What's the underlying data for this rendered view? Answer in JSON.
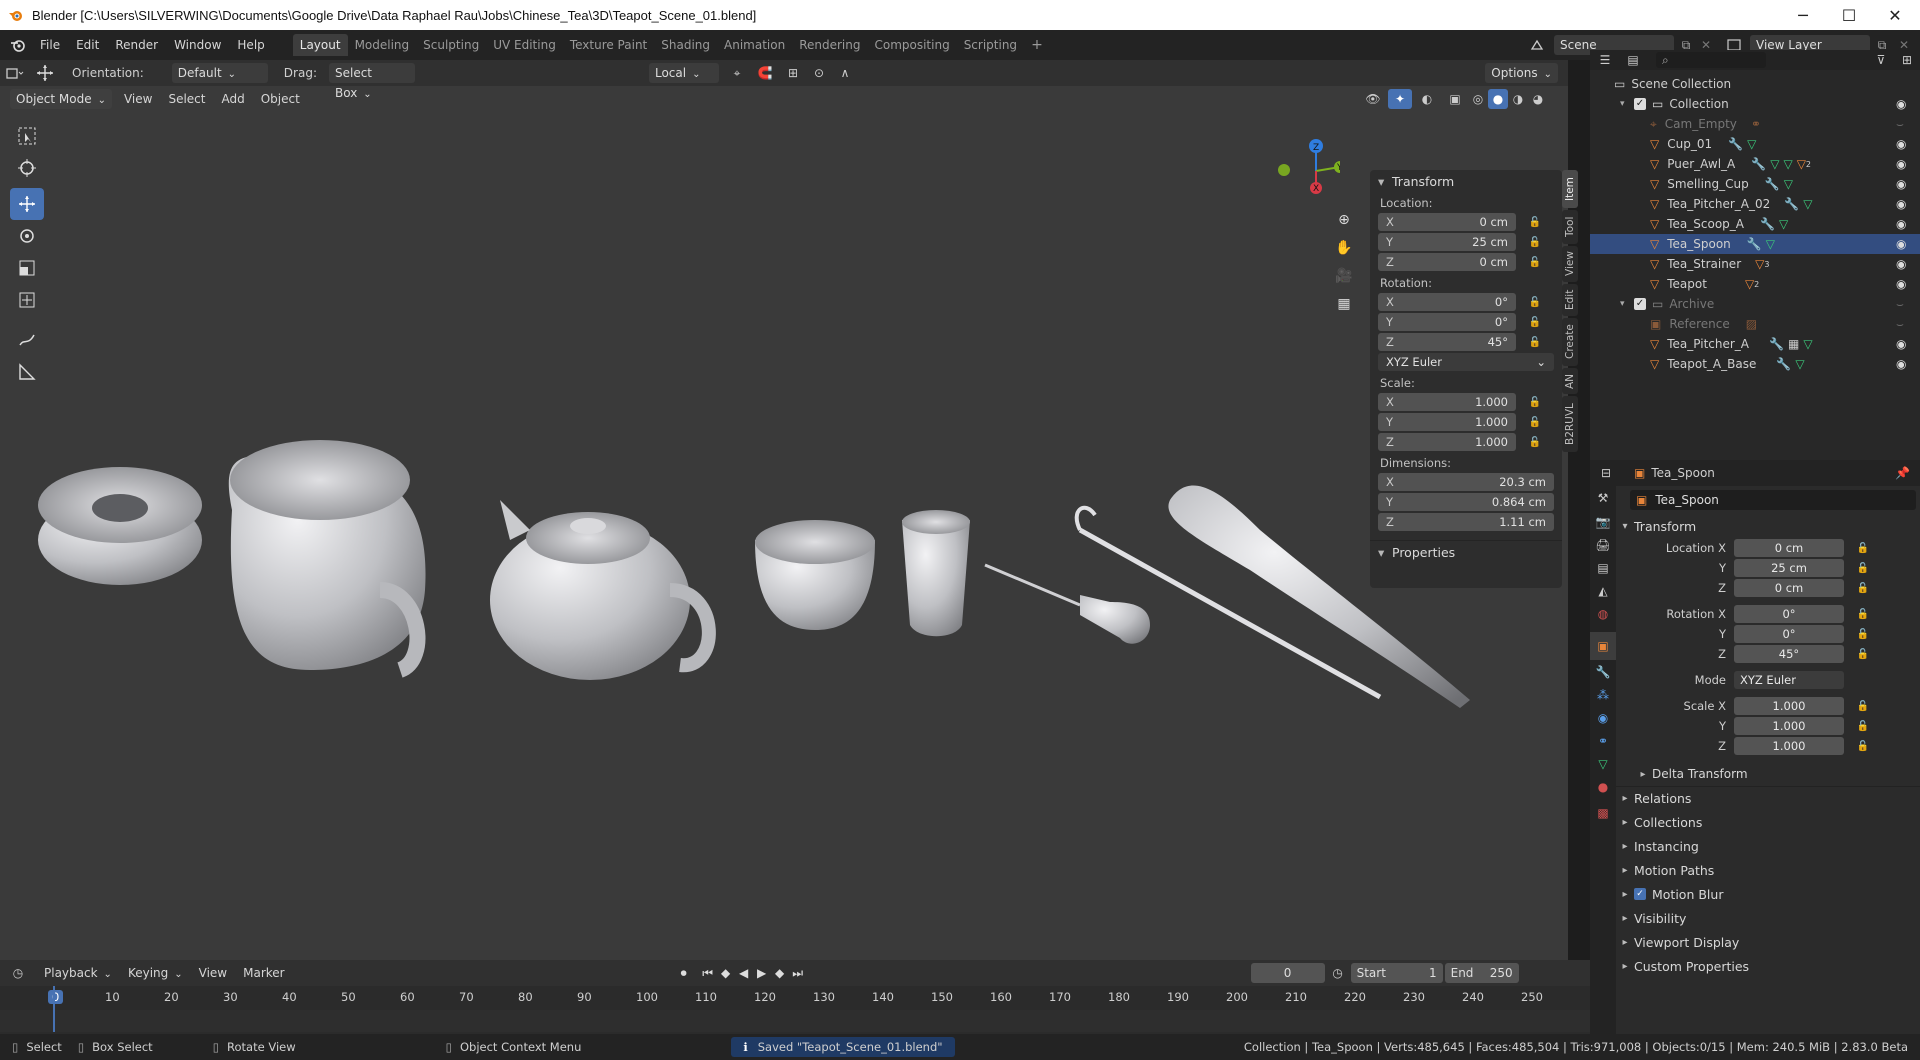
{
  "window": {
    "title": "Blender [C:\\Users\\SILVERWING\\Documents\\Google Drive\\Data Raphael Rau\\Jobs\\Chinese_Tea\\3D\\Teapot_Scene_01.blend]"
  },
  "menu": [
    "File",
    "Edit",
    "Render",
    "Window",
    "Help"
  ],
  "workspaces": [
    "Layout",
    "Modeling",
    "Sculpting",
    "UV Editing",
    "Texture Paint",
    "Shading",
    "Animation",
    "Rendering",
    "Compositing",
    "Scripting"
  ],
  "active_workspace": "Layout",
  "scene": {
    "label": "Scene",
    "view_layer": "View Layer"
  },
  "tool_header": {
    "orientation_label": "Orientation:",
    "orientation_value": "Default",
    "drag_label": "Drag:",
    "drag_value": "Select Box",
    "pivot": "Local",
    "options": "Options"
  },
  "viewport_header": {
    "mode": "Object Mode",
    "items": [
      "View",
      "Select",
      "Add",
      "Object"
    ]
  },
  "npanel": {
    "header": "Transform",
    "location_label": "Location:",
    "location": [
      {
        "axis": "X",
        "value": "0 cm"
      },
      {
        "axis": "Y",
        "value": "25 cm"
      },
      {
        "axis": "Z",
        "value": "0 cm"
      }
    ],
    "rotation_label": "Rotation:",
    "rotation": [
      {
        "axis": "X",
        "value": "0°"
      },
      {
        "axis": "Y",
        "value": "0°"
      },
      {
        "axis": "Z",
        "value": "45°"
      }
    ],
    "rotation_mode": "XYZ Euler",
    "scale_label": "Scale:",
    "scale": [
      {
        "axis": "X",
        "value": "1.000"
      },
      {
        "axis": "Y",
        "value": "1.000"
      },
      {
        "axis": "Z",
        "value": "1.000"
      }
    ],
    "dimensions_label": "Dimensions:",
    "dimensions": [
      {
        "axis": "X",
        "value": "20.3 cm"
      },
      {
        "axis": "Y",
        "value": "0.864 cm"
      },
      {
        "axis": "Z",
        "value": "1.11 cm"
      }
    ],
    "properties": "Properties",
    "tabs": [
      "Item",
      "Tool",
      "View",
      "Edit",
      "Create",
      "AN",
      "B2RUVL"
    ]
  },
  "outliner": {
    "root": "Scene Collection",
    "collection": "Collection",
    "items": [
      "Cam_Empty",
      "Cup_01",
      "Puer_Awl_A",
      "Smelling_Cup",
      "Tea_Pitcher_A_02",
      "Tea_Scoop_A",
      "Tea_Spoon",
      "Tea_Strainer",
      "Teapot"
    ],
    "badge_puer": "2",
    "badge_strainer": "3",
    "badge_teapot": "2",
    "archive": "Archive",
    "archive_items": [
      "Reference",
      "Tea_Pitcher_A",
      "Teapot_A_Base"
    ]
  },
  "properties": {
    "object": "Tea_Spoon",
    "object_field": "Tea_Spoon",
    "transform_header": "Transform",
    "location": [
      {
        "label": "Location X",
        "value": "0 cm"
      },
      {
        "label": "Y",
        "value": "25 cm"
      },
      {
        "label": "Z",
        "value": "0 cm"
      }
    ],
    "rotation": [
      {
        "label": "Rotation X",
        "value": "0°"
      },
      {
        "label": "Y",
        "value": "0°"
      },
      {
        "label": "Z",
        "value": "45°"
      }
    ],
    "mode_label": "Mode",
    "mode_value": "XYZ Euler",
    "scale": [
      {
        "label": "Scale X",
        "value": "1.000"
      },
      {
        "label": "Y",
        "value": "1.000"
      },
      {
        "label": "Z",
        "value": "1.000"
      }
    ],
    "delta": "Delta Transform",
    "sections": [
      "Relations",
      "Collections",
      "Instancing",
      "Motion Paths",
      "Motion Blur",
      "Visibility",
      "Viewport Display",
      "Custom Properties"
    ]
  },
  "timeline": {
    "menus": [
      "Playback",
      "Keying",
      "View",
      "Marker"
    ],
    "current_frame": "0",
    "start_label": "Start",
    "start": "1",
    "end_label": "End",
    "end": "250",
    "ticks": [
      "0",
      "10",
      "20",
      "30",
      "40",
      "50",
      "60",
      "70",
      "80",
      "90",
      "100",
      "110",
      "120",
      "130",
      "140",
      "150",
      "160",
      "170",
      "180",
      "190",
      "200",
      "210",
      "220",
      "230",
      "240",
      "250"
    ]
  },
  "statusbar": {
    "select": "Select",
    "box_select": "Box Select",
    "rotate": "Rotate View",
    "context": "Object Context Menu",
    "saved": "Saved \"Teapot_Scene_01.blend\"",
    "stats": "Collection | Tea_Spoon | Verts:485,645 | Faces:485,504 | Tris:971,008 | Objects:0/15 | Mem: 240.5 MiB | 2.83.0 Beta"
  },
  "colors": {
    "accent": "#4772b3",
    "viewport": "#3a3a3a",
    "selected": "#334d80",
    "object_orange": "#e8853a",
    "mesh_green": "#3bc87a",
    "modifier_blue": "#5a9ee8"
  }
}
